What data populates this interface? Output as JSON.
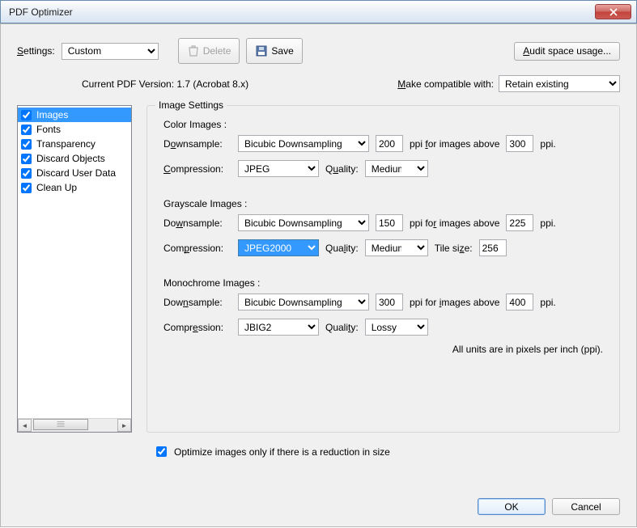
{
  "window": {
    "title": "PDF Optimizer"
  },
  "toolbar": {
    "settings_label": "Settings:",
    "settings_value": "Custom",
    "delete_label": "Delete",
    "save_label": "Save",
    "audit_label": "Audit space usage..."
  },
  "versionrow": {
    "current_label": "Current PDF Version: 1.7 (Acrobat 8.x)",
    "compat_label": "Make compatible with:",
    "compat_value": "Retain existing"
  },
  "sidebar": {
    "items": [
      {
        "label": "Images",
        "checked": true,
        "selected": true
      },
      {
        "label": "Fonts",
        "checked": true,
        "selected": false
      },
      {
        "label": "Transparency",
        "checked": true,
        "selected": false
      },
      {
        "label": "Discard Objects",
        "checked": true,
        "selected": false
      },
      {
        "label": "Discard User Data",
        "checked": true,
        "selected": false
      },
      {
        "label": "Clean Up",
        "checked": true,
        "selected": false
      }
    ]
  },
  "panel": {
    "legend": "Image Settings",
    "color": {
      "title": "Color Images :",
      "downsample_label": "Downsample:",
      "downsample_value": "Bicubic Downsampling to",
      "ppi_value": "200",
      "above_label": "ppi for images above",
      "above_value": "300",
      "ppi_suffix": "ppi.",
      "compression_label": "Compression:",
      "compression_value": "JPEG",
      "quality_label": "Quality:",
      "quality_value": "Medium"
    },
    "gray": {
      "title": "Grayscale Images :",
      "downsample_label": "Downsample:",
      "downsample_value": "Bicubic Downsampling to",
      "ppi_value": "150",
      "above_label": "ppi for images above",
      "above_value": "225",
      "ppi_suffix": "ppi.",
      "compression_label": "Compression:",
      "compression_value": "JPEG2000",
      "quality_label": "Quality:",
      "quality_value": "Medium",
      "tile_label": "Tile size:",
      "tile_value": "256"
    },
    "mono": {
      "title": "Monochrome Images :",
      "downsample_label": "Downsample:",
      "downsample_value": "Bicubic Downsampling to",
      "ppi_value": "300",
      "above_label": "ppi for images above",
      "above_value": "400",
      "ppi_suffix": "ppi.",
      "compression_label": "Compression:",
      "compression_value": "JBIG2",
      "quality_label": "Quality:",
      "quality_value": "Lossy"
    },
    "note": "All units are in pixels per inch (ppi)."
  },
  "optimize_check": {
    "label": "Optimize images only if there is a reduction in size",
    "checked": true
  },
  "footer": {
    "ok": "OK",
    "cancel": "Cancel"
  }
}
